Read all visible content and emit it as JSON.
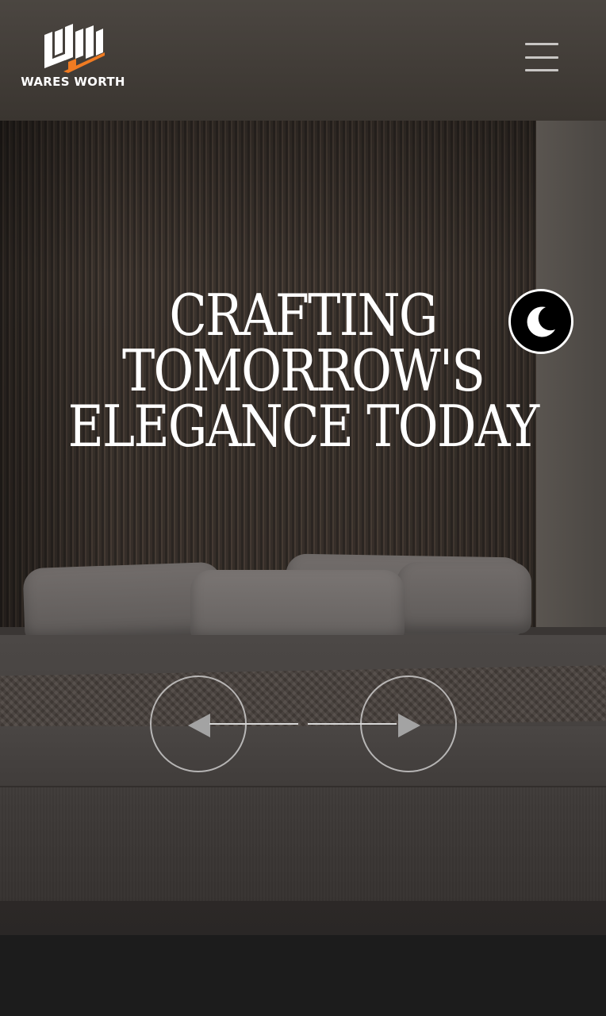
{
  "brand": {
    "logo_text": "WARES WORTH",
    "accent_color": "#f07b22",
    "logo_color": "#ffffff"
  },
  "header": {
    "menu_icon": "hamburger-menu-icon"
  },
  "hero": {
    "title_lines": [
      "CRAFTING",
      "TOMORROW'S",
      "ELEGANCE TODAY"
    ],
    "title_color": "#ffffff"
  },
  "theme_toggle": {
    "icon": "moon-icon",
    "mode": "dark"
  },
  "slider": {
    "prev_icon": "arrow-left-icon",
    "next_icon": "arrow-right-icon"
  },
  "colors": {
    "footer_bar": "#1c1c1c",
    "control_stroke": "#dcdcdc"
  }
}
